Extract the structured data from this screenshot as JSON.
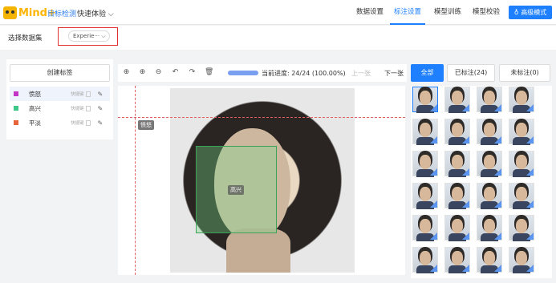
{
  "app": {
    "logo_text": "Mind+"
  },
  "header": {
    "nav_primary": "目标检测",
    "nav_secondary": "快速体验 ⌵",
    "tabs": [
      {
        "label": "数据设置"
      },
      {
        "label": "标注设置"
      },
      {
        "label": "模型训练"
      },
      {
        "label": "模型校验"
      }
    ],
    "active_tab": "标注设置",
    "advanced_button": "高级模式"
  },
  "dataset": {
    "label": "选择数据集",
    "selected": "Experie··· ⌵"
  },
  "tags": {
    "create_button": "创建标签",
    "items": [
      {
        "name": "愤怒",
        "color": "#c535c5",
        "hotkey_label": "快捷键"
      },
      {
        "name": "高兴",
        "color": "#3ec98a",
        "hotkey_label": "快捷键"
      },
      {
        "name": "平淡",
        "color": "#e8643a",
        "hotkey_label": "快捷键"
      }
    ]
  },
  "toolbar": {
    "icons": [
      "crosshair-icon",
      "zoom-in-icon",
      "zoom-out-icon",
      "undo-icon",
      "redo-icon",
      "delete-icon"
    ],
    "progress_fraction": 1.0,
    "progress_text": "当前进度: 24/24 (100.00%)",
    "prev_label": "上一张",
    "next_label": "下一张"
  },
  "filters": {
    "all": "全部",
    "labeled": "已标注(24)",
    "unlabeled": "未标注(0)"
  },
  "canvas": {
    "box_label": "高兴",
    "cursor_label": "愤怒"
  }
}
